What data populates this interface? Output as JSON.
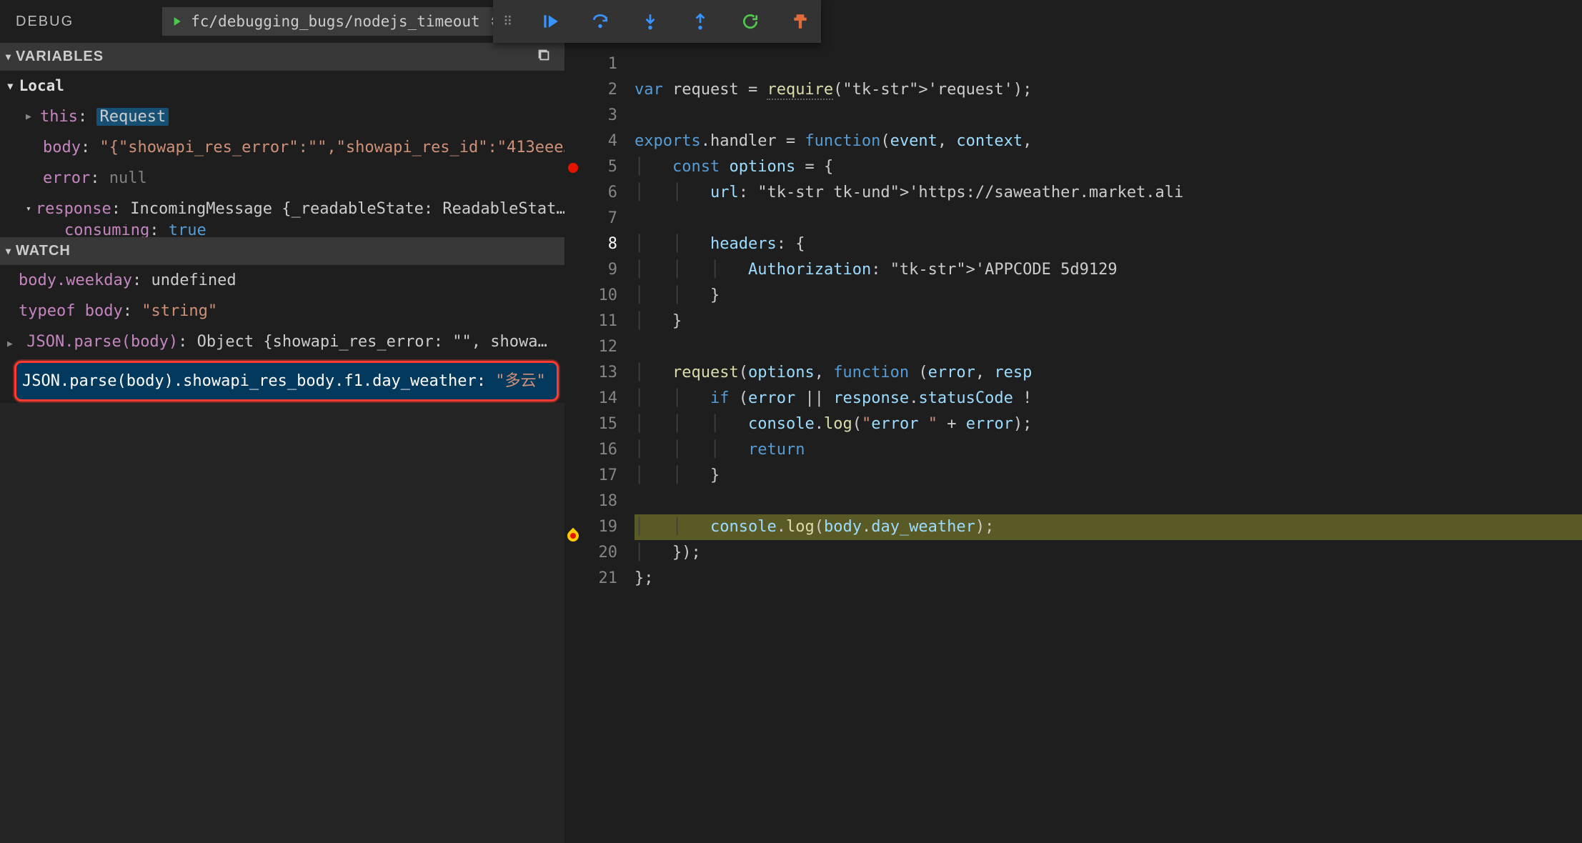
{
  "topbar": {
    "debug_label": "DEBUG",
    "config_name": "fc/debugging_bugs/nodejs_timeout"
  },
  "debug_actions": [
    "continue",
    "step-over",
    "step-into",
    "step-out",
    "restart",
    "stop"
  ],
  "sections": {
    "variables_title": "VARIABLES",
    "watch_title": "WATCH"
  },
  "variables": {
    "scope": "Local",
    "items": [
      {
        "key": "this",
        "value": "Request",
        "type": "object",
        "expandable": true,
        "boxed": true
      },
      {
        "key": "body",
        "value": "\"{\"showapi_res_error\":\"\",\"showapi_res_id\":\"413eee…",
        "type": "string"
      },
      {
        "key": "error",
        "value": "null",
        "type": "null"
      },
      {
        "key": "response",
        "value": "IncomingMessage {_readableState: ReadableStat…",
        "type": "object",
        "expandable": true,
        "expanded": true
      }
    ],
    "truncated_line": {
      "key": "consuming",
      "value": "true"
    }
  },
  "watch": [
    {
      "expr": "body.weekday",
      "value": "undefined",
      "vclass": "plain"
    },
    {
      "expr": "typeof body",
      "value": "\"string\"",
      "vclass": "string"
    },
    {
      "expr": "JSON.parse(body)",
      "value": "Object {showapi_res_error: \"\", showapi_…",
      "vclass": "plain",
      "expandable": true
    },
    {
      "expr": "JSON.parse(body).showapi_res_body.f1.day_weather",
      "value": "\"多云\"",
      "vclass": "string",
      "highlighted": true
    }
  ],
  "editor": {
    "breakpoint_line": 5,
    "current_line": 19,
    "lines": [
      "",
      "var request = require('request');",
      "",
      "exports.handler = function(event, context,",
      "    const options = {",
      "        url: 'https://saweather.market.ali",
      "",
      "        headers: {",
      "            Authorization: 'APPCODE 5d9129",
      "        }",
      "    }",
      "",
      "    request(options, function (error, resp",
      "        if (error || response.statusCode !",
      "            console.log(\"error \" + error);",
      "            return",
      "        }",
      "",
      "        console.log(body.day_weather);",
      "    });",
      "};"
    ]
  }
}
